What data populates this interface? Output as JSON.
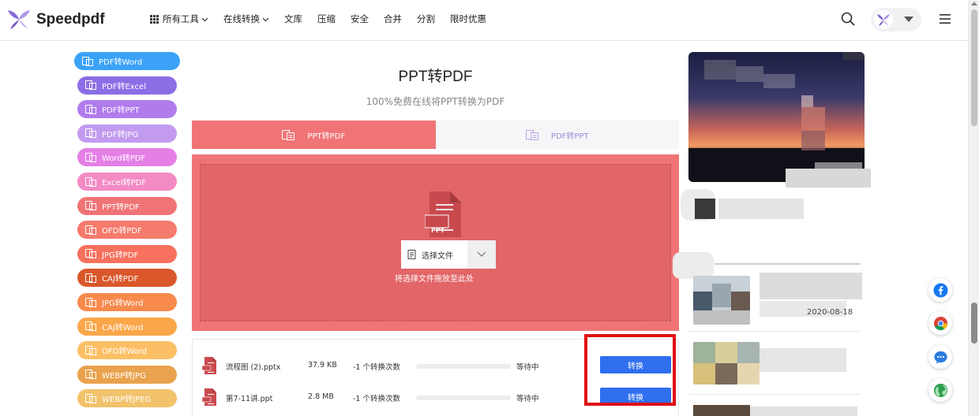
{
  "header": {
    "logo_text": "Speedpdf",
    "nav": [
      {
        "label": "所有工具",
        "has_grid_icon": true,
        "has_dropdown": true
      },
      {
        "label": "在线转换",
        "has_grid_icon": false,
        "has_dropdown": true
      },
      {
        "label": "文库",
        "has_grid_icon": false,
        "has_dropdown": false
      },
      {
        "label": "压缩",
        "has_grid_icon": false,
        "has_dropdown": false
      },
      {
        "label": "安全",
        "has_grid_icon": false,
        "has_dropdown": false
      },
      {
        "label": "合并",
        "has_grid_icon": false,
        "has_dropdown": false
      },
      {
        "label": "分割",
        "has_grid_icon": false,
        "has_dropdown": false
      },
      {
        "label": "限时优惠",
        "has_grid_icon": false,
        "has_dropdown": false
      }
    ]
  },
  "sidebar": {
    "items": [
      {
        "label": "PDF转Word",
        "color": "#3ba2f8"
      },
      {
        "label": "PDF转Excel",
        "color": "#8b6ee6"
      },
      {
        "label": "PDF转PPT",
        "color": "#b07cec"
      },
      {
        "label": "PDF转JPG",
        "color": "#c29bf0"
      },
      {
        "label": "Word转PDF",
        "color": "#e57fe6"
      },
      {
        "label": "Excel转PDF",
        "color": "#f38ac4"
      },
      {
        "label": "PPT转PDF",
        "color": "#f07476"
      },
      {
        "label": "OFD转PDF",
        "color": "#f57b6c"
      },
      {
        "label": "JPG转PDF",
        "color": "#f7715e"
      },
      {
        "label": "CAJ转PDF",
        "color": "#d9572a"
      },
      {
        "label": "JPG转Word",
        "color": "#f98a4d"
      },
      {
        "label": "CAJ转Word",
        "color": "#fba64a"
      },
      {
        "label": "OFD转Word",
        "color": "#fcbf66"
      },
      {
        "label": "WEBP转JPG",
        "color": "#e9a24d"
      },
      {
        "label": "WEBP转JPEG",
        "color": "#f2c26c"
      }
    ]
  },
  "main": {
    "title": "PPT转PDF",
    "subtitle": "100%免费在线将PPT转换为PDF",
    "tabs": [
      {
        "label": "PPT转PDF",
        "active": true
      },
      {
        "label": "PDF转PPT",
        "active": false
      }
    ],
    "dropzone": {
      "file_type_badge": "PPT",
      "choose_label": "选择文件",
      "hint": "将选择文件拖放至此处"
    },
    "files": [
      {
        "name": "流程图 (2).pptx",
        "size": "37.9 KB",
        "count": "-1 个转换次数",
        "progress": 0,
        "status": "等待中",
        "action": "转换"
      },
      {
        "name": "第7-11讲.ppt",
        "size": "2.8 MB",
        "count": "-1 个转换次数",
        "progress": 0,
        "status": "等待中",
        "action": "转换"
      }
    ]
  },
  "right": {
    "article_date": "2020-08-18"
  },
  "colors": {
    "accent": "#f07476",
    "convert_button": "#2f6ff0",
    "highlight": "#e01010"
  }
}
